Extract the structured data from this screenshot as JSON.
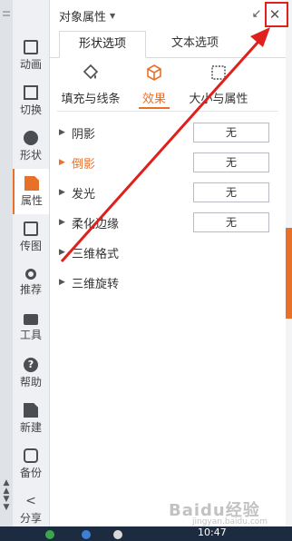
{
  "rail": {
    "items": [
      {
        "label": "动画",
        "icon": "animation-icon"
      },
      {
        "label": "切换",
        "icon": "transition-icon"
      },
      {
        "label": "形状",
        "icon": "shape-icon"
      },
      {
        "label": "属性",
        "icon": "properties-icon"
      },
      {
        "label": "传图",
        "icon": "upload-image-icon"
      },
      {
        "label": "推荐",
        "icon": "recommend-icon"
      },
      {
        "label": "工具",
        "icon": "toolbox-icon"
      },
      {
        "label": "帮助",
        "icon": "help-icon"
      },
      {
        "label": "新建",
        "icon": "new-doc-icon"
      },
      {
        "label": "备份",
        "icon": "backup-icon"
      },
      {
        "label": "分享",
        "icon": "share-icon"
      }
    ],
    "active_index": 3
  },
  "panel": {
    "title": "对象属性",
    "tabs": [
      "形状选项",
      "文本选项"
    ],
    "subtabs": [
      "填充与线条",
      "效果",
      "大小与属性"
    ],
    "active_subtab": 1,
    "effects": [
      {
        "label": "阴影",
        "value": "无"
      },
      {
        "label": "倒影",
        "value": "无",
        "active": true
      },
      {
        "label": "发光",
        "value": "无"
      },
      {
        "label": "柔化边缘",
        "value": "无"
      },
      {
        "label": "三维格式"
      },
      {
        "label": "三维旋转"
      }
    ]
  },
  "taskbar": {
    "time": "10:47"
  },
  "watermark": {
    "text": "Baidu经验",
    "sub": "jingyan.baidu.com"
  },
  "colors": {
    "accent": "#e8712a",
    "highlight": "#e0201c"
  }
}
